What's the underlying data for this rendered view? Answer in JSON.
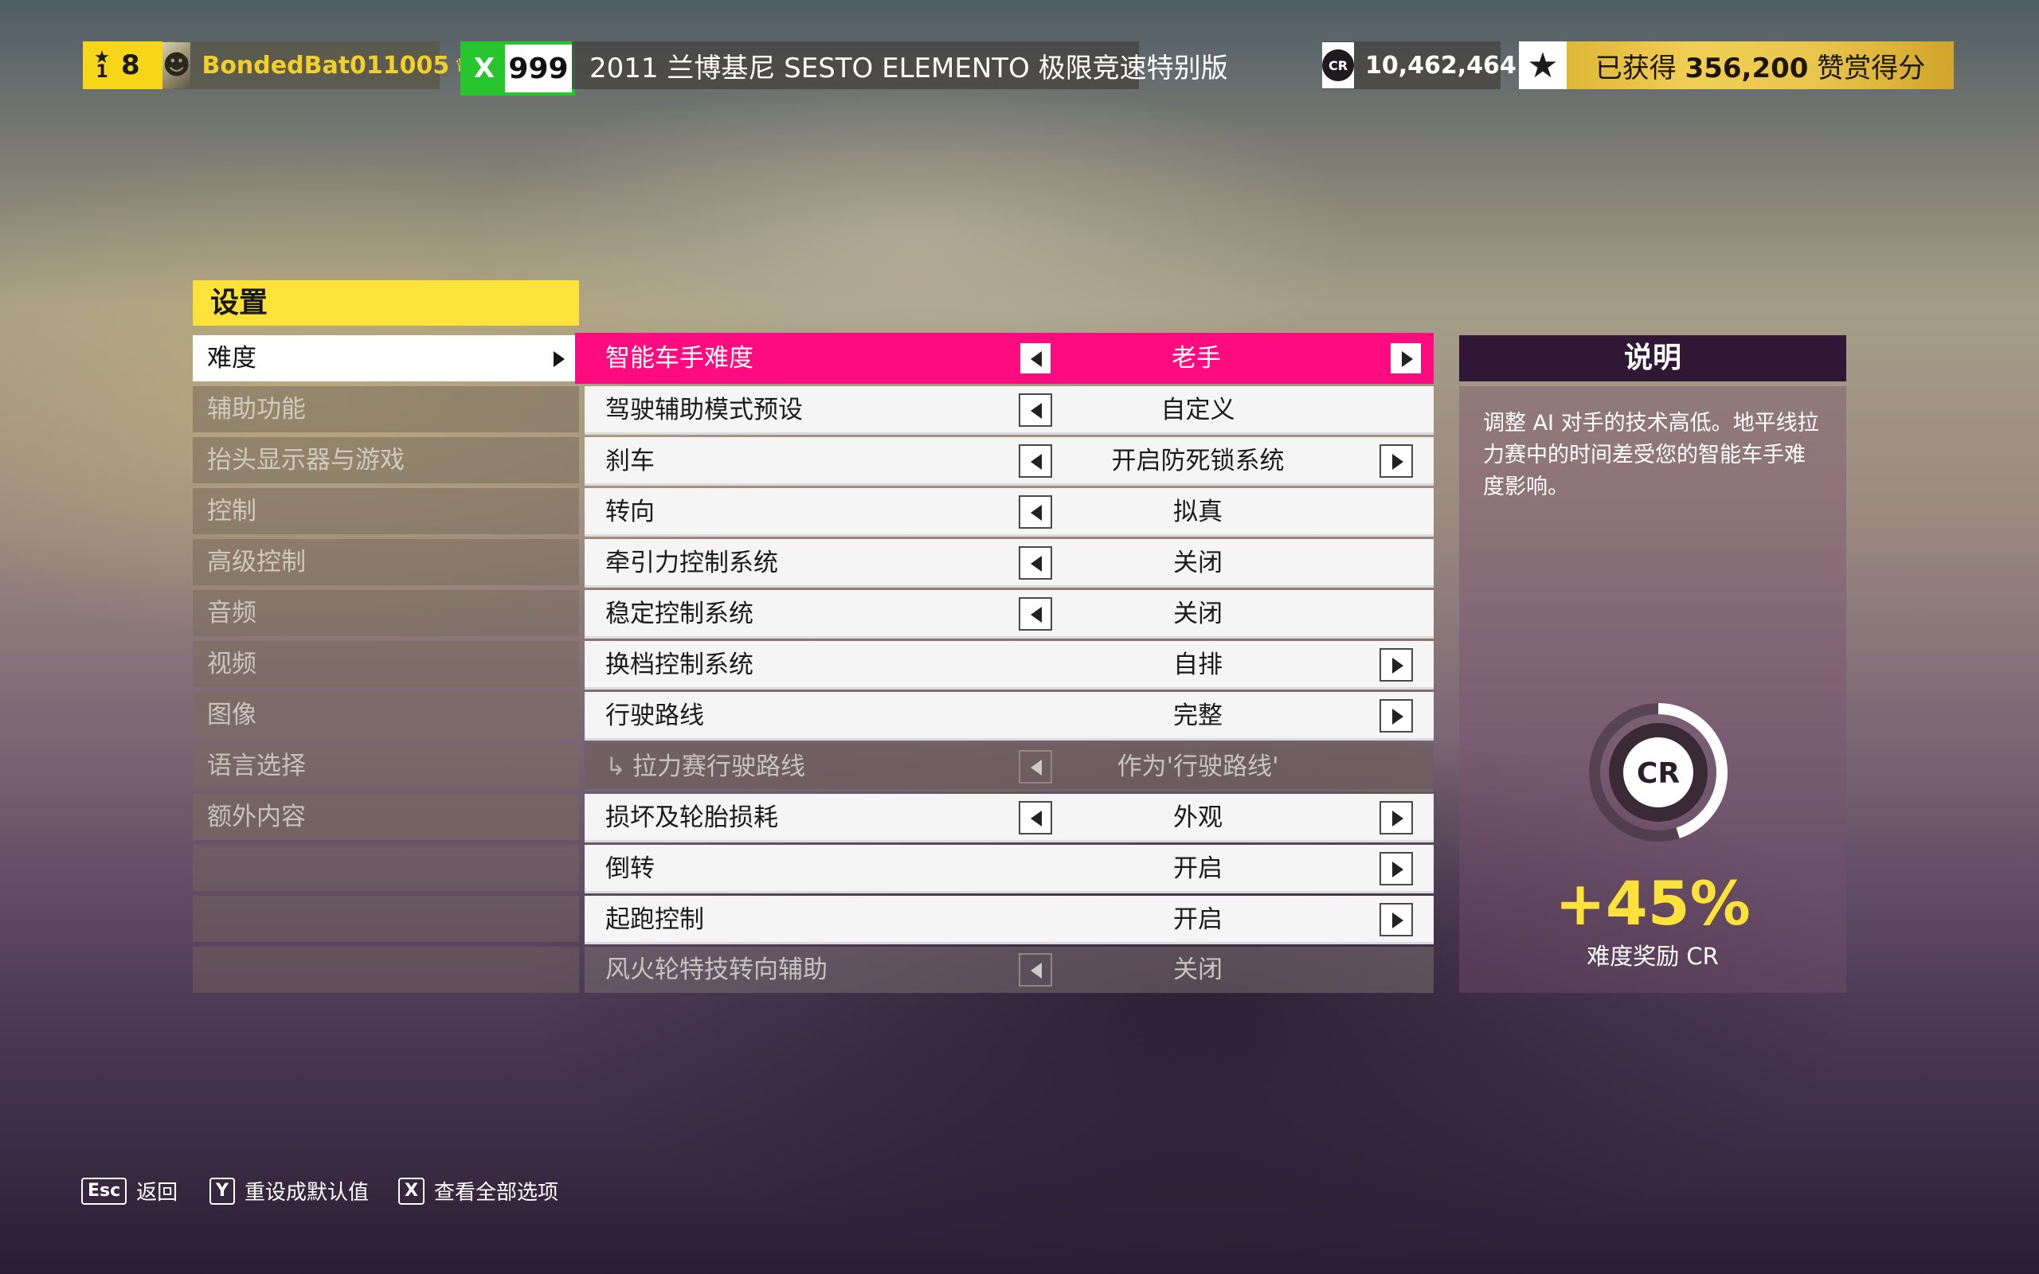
{
  "hud": {
    "level": "8",
    "gamertag": "BondedBat011005",
    "rank_letter": "X",
    "rank_value": "999",
    "car_name": "2011 兰博基尼 SESTO ELEMENTO 极限竞速特别版",
    "credits_icon": "CR",
    "credits": "10,462,464",
    "reward_prefix": "已获得",
    "reward_points": "356,200",
    "reward_suffix": "赞赏得分"
  },
  "menu": {
    "title": "设置",
    "items": [
      {
        "label": "难度",
        "active": true
      },
      {
        "label": "辅助功能"
      },
      {
        "label": "抬头显示器与游戏"
      },
      {
        "label": "控制"
      },
      {
        "label": "高级控制"
      },
      {
        "label": "音频"
      },
      {
        "label": "视频"
      },
      {
        "label": "图像"
      },
      {
        "label": "语言选择"
      },
      {
        "label": "额外内容"
      }
    ]
  },
  "settings": [
    {
      "label": "智能车手难度",
      "value": "老手"
    },
    {
      "label": "驾驶辅助模式预设",
      "value": "自定义"
    },
    {
      "label": "刹车",
      "value": "开启防死锁系统"
    },
    {
      "label": "转向",
      "value": "拟真"
    },
    {
      "label": "牵引力控制系统",
      "value": "关闭"
    },
    {
      "label": "稳定控制系统",
      "value": "关闭"
    },
    {
      "label": "换档控制系统",
      "value": "自排"
    },
    {
      "label": "行驶路线",
      "value": "完整"
    },
    {
      "label": "拉力赛行驶路线",
      "value": "作为'行驶路线'"
    },
    {
      "label": "损坏及轮胎损耗",
      "value": "外观"
    },
    {
      "label": "倒转",
      "value": "开启"
    },
    {
      "label": "起跑控制",
      "value": "开启"
    },
    {
      "label": "风火轮特技转向辅助",
      "value": "关闭"
    }
  ],
  "description": {
    "title": "说明",
    "text": "调整 AI 对手的技术高低。地平线拉力赛中的时间差受您的智能车手难度影响。",
    "ring_label": "CR",
    "bonus": "+45%",
    "bonus_fraction": 0.45,
    "bonus_label": "难度奖励 CR"
  },
  "footer": [
    {
      "key": "Esc",
      "label": "返回"
    },
    {
      "key": "Y",
      "label": "重设成默认值"
    },
    {
      "key": "X",
      "label": "查看全部选项"
    }
  ],
  "colors": {
    "accent_pink": "#ff0b80",
    "accent_yellow": "#fde23a",
    "rank_green": "#27c62f"
  }
}
